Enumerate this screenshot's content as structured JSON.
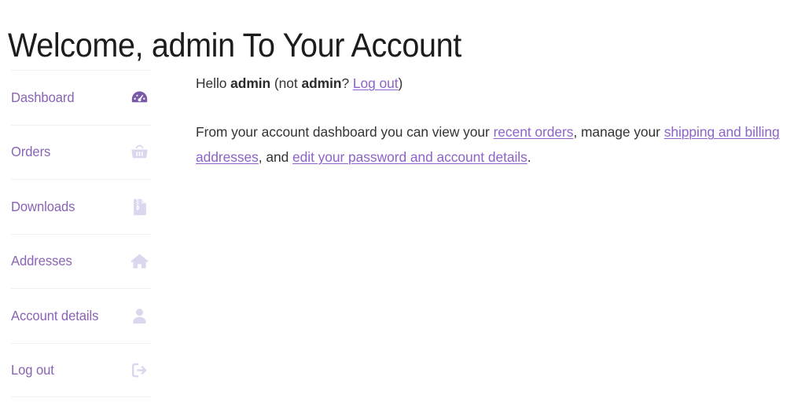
{
  "page": {
    "title": "Welcome, admin To Your Account"
  },
  "sidebar": {
    "items": [
      {
        "label": "Dashboard",
        "icon": "gauge-icon",
        "active": true
      },
      {
        "label": "Orders",
        "icon": "basket-icon",
        "active": false
      },
      {
        "label": "Downloads",
        "icon": "zip-file-icon",
        "active": false
      },
      {
        "label": "Addresses",
        "icon": "house-icon",
        "active": false
      },
      {
        "label": "Account details",
        "icon": "person-icon",
        "active": false
      },
      {
        "label": "Log out",
        "icon": "sign-out-icon",
        "active": false
      }
    ]
  },
  "content": {
    "greeting": {
      "hello": "Hello ",
      "username": "admin",
      "not_open": " (not ",
      "not_username": "admin",
      "question": "? ",
      "logout_link": "Log out",
      "close": ")"
    },
    "intro": {
      "part1": "From your account dashboard you can view your ",
      "link_orders": "recent orders",
      "part2": ", manage your ",
      "link_addresses": "shipping and billing addresses",
      "part3": ", and ",
      "link_account": "edit your password and account details",
      "part4": "."
    }
  },
  "colors": {
    "nav_link": "#8a63b5",
    "content_link": "#8d63c8",
    "icon_muted": "#ddd6ef",
    "icon_active": "#7a5aa8",
    "divider": "#efefef",
    "body_text": "#333333",
    "heading": "#1c1c1c"
  }
}
